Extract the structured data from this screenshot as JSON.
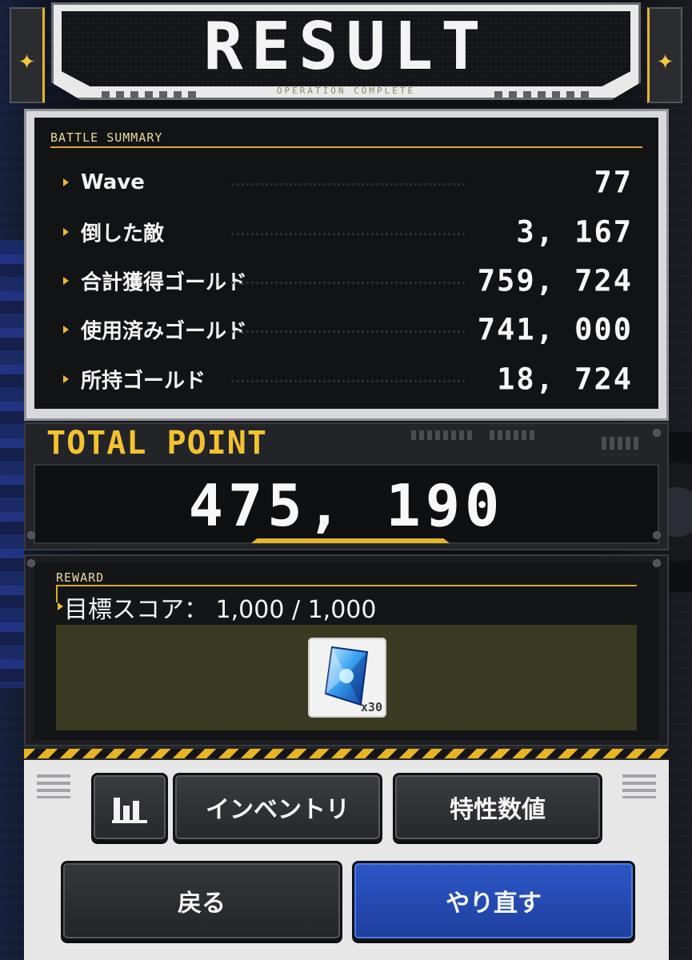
{
  "header": {
    "title": "RESULT",
    "subtitle": "OPERATION COMPLETE"
  },
  "battle_summary": {
    "label": "BATTLE SUMMARY",
    "rows": [
      {
        "label": "Wave",
        "value": "77"
      },
      {
        "label": "倒した敵",
        "value": "3, 167"
      },
      {
        "label": "合計獲得ゴールド",
        "value": "759, 724"
      },
      {
        "label": "使用済みゴールド",
        "value": "741, 000"
      },
      {
        "label": "所持ゴールド",
        "value": "18, 724"
      }
    ]
  },
  "total_point": {
    "label": "TOTAL POINT",
    "value": "475, 190"
  },
  "reward": {
    "label": "REWARD",
    "target": "目標スコア： 1,000 / 1,000",
    "item": {
      "icon": "crystal-icon",
      "quantity": "x30"
    }
  },
  "buttons": {
    "stats_icon": "bar-chart-icon",
    "inventory": "インベントリ",
    "traits": "特性数値",
    "back": "戻る",
    "retry": "やり直す"
  },
  "colors": {
    "accent_gold": "#e6b521",
    "retry_blue": "#2148b0",
    "panel_dark": "#121315"
  }
}
